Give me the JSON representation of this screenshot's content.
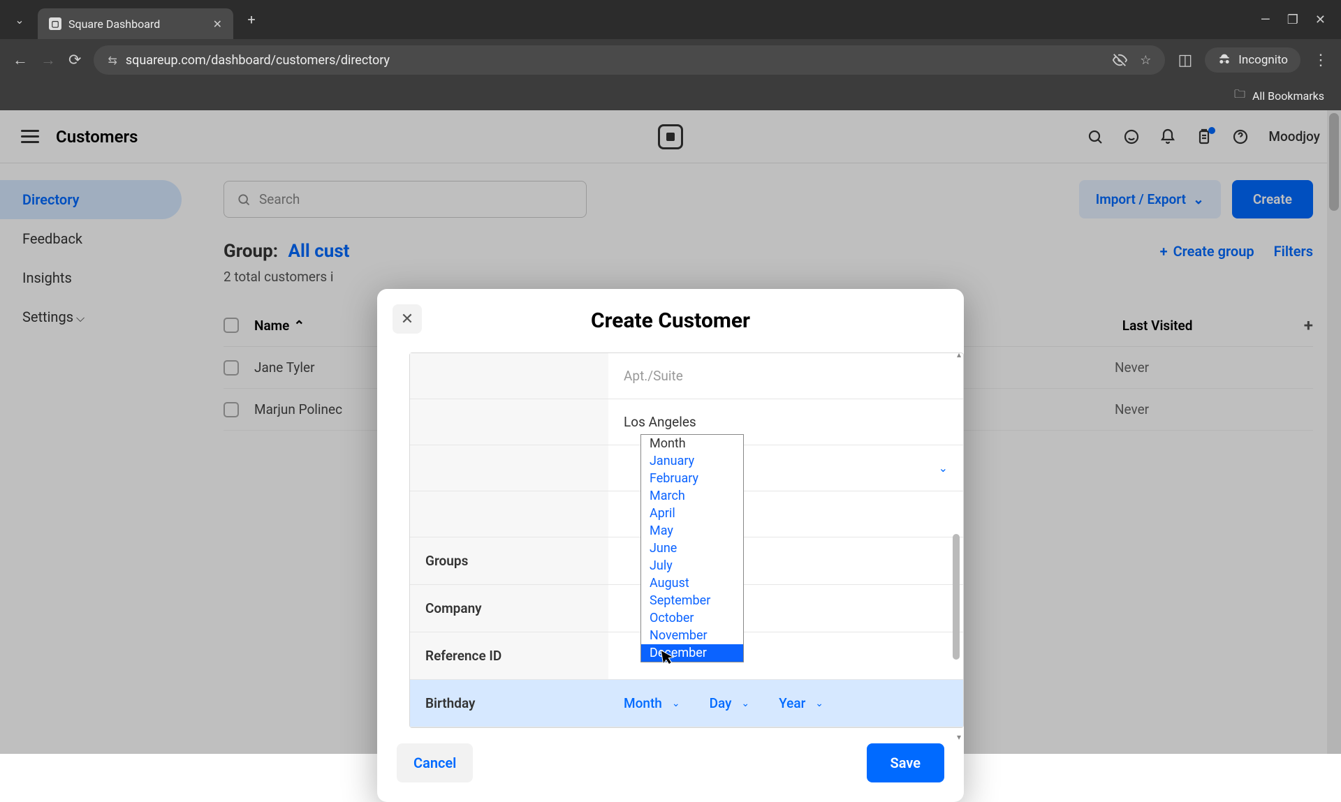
{
  "browser": {
    "tab_title": "Square Dashboard",
    "url": "squareup.com/dashboard/customers/directory",
    "incognito_label": "Incognito",
    "bookmarks_label": "All Bookmarks"
  },
  "header": {
    "app_section": "Customers",
    "user": "Moodjoy"
  },
  "sidebar": {
    "items": [
      {
        "label": "Directory",
        "active": true
      },
      {
        "label": "Feedback"
      },
      {
        "label": "Insights"
      },
      {
        "label": "Settings"
      }
    ]
  },
  "toolbar": {
    "search_placeholder": "Search",
    "import_label": "Import / Export",
    "create_label": "Create"
  },
  "group": {
    "prefix": "Group:",
    "value": "All cust",
    "count_text": "2 total customers i",
    "create_group_label": "Create group",
    "filters_label": "Filters"
  },
  "table": {
    "col_name": "Name",
    "col_visited": "Last Visited",
    "rows": [
      {
        "name": "Jane Tyler",
        "visited": "Never"
      },
      {
        "name": "Marjun Polinec",
        "visited": "Never"
      }
    ]
  },
  "modal": {
    "title": "Create Customer",
    "apt_placeholder": "Apt./Suite",
    "city_value": "Los Angeles",
    "labels": {
      "groups": "Groups",
      "company": "Company",
      "reference": "Reference ID",
      "birthday": "Birthday"
    },
    "birthday": {
      "month": "Month",
      "day": "Day",
      "year": "Year"
    },
    "month_options": [
      "Month",
      "January",
      "February",
      "March",
      "April",
      "May",
      "June",
      "July",
      "August",
      "September",
      "October",
      "November",
      "December"
    ],
    "selected_month": "December",
    "cancel": "Cancel",
    "save": "Save"
  }
}
